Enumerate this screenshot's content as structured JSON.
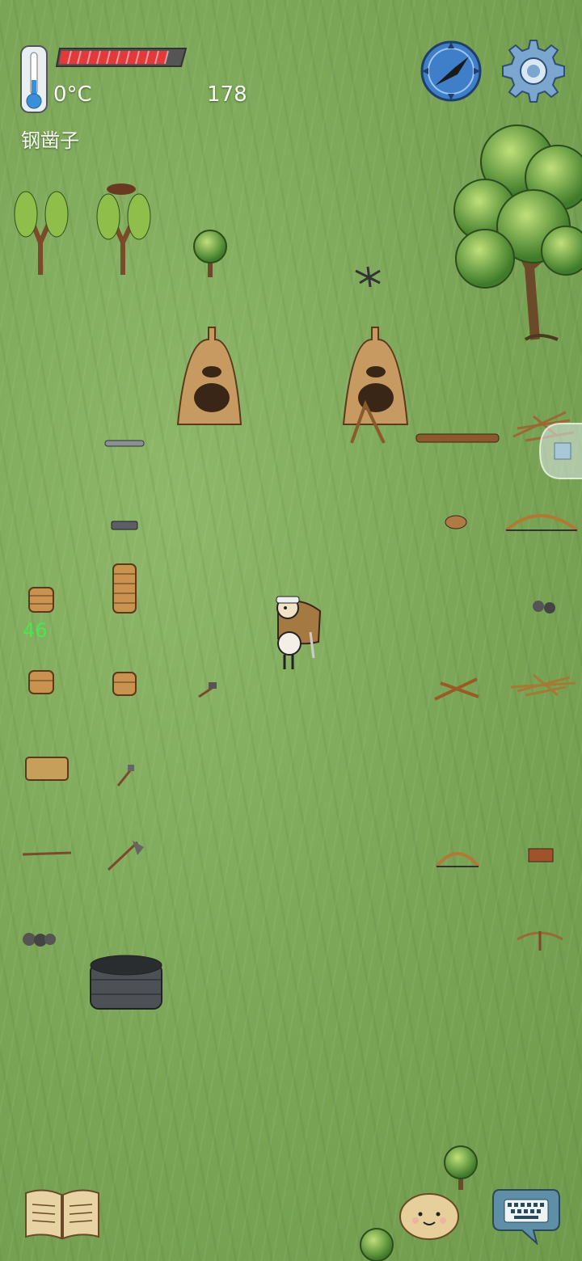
{
  "hud": {
    "temperature": "0°C",
    "counter": "178",
    "held_item": "钢凿子",
    "health_fraction": 0.93,
    "health_color": "#e23a3a"
  },
  "world": {
    "stack_count": "46"
  },
  "icons": {
    "thermometer": "thermometer-icon",
    "compass": "compass-icon",
    "settings": "gear-icon",
    "recipe_book": "book-icon",
    "emote": "potato-face-icon",
    "chat": "keyboard-icon"
  }
}
